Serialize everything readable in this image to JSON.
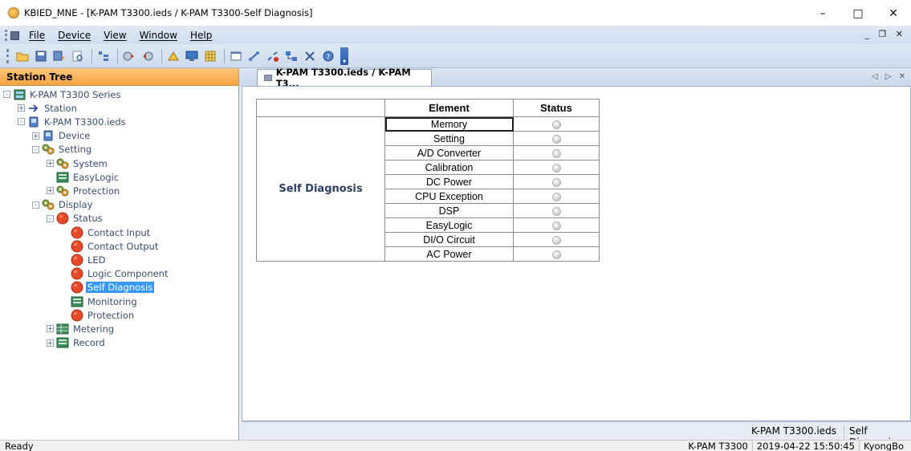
{
  "window": {
    "title": "KBIED_MNE - [K-PAM T3300.ieds / K-PAM T3300-Self Diagnosis]",
    "minimize": "–",
    "maximize": "□",
    "close": "✕"
  },
  "menu": {
    "items": [
      "File",
      "Device",
      "View",
      "Window",
      "Help"
    ],
    "mdi_controls": "_ ͆ ×"
  },
  "toolbar": {
    "icons": [
      "open-folder-icon",
      "save-icon",
      "save-all-icon",
      "print-preview-icon",
      "tree-view-icon",
      "settings-write-icon",
      "settings-read-icon",
      "compare-icon",
      "monitor-icon",
      "grid-icon",
      "window-icon",
      "connect-icon",
      "disconnect-icon",
      "network-icon",
      "close-icon",
      "help-icon"
    ]
  },
  "station_tree": {
    "header": "Station Tree",
    "nodes": [
      {
        "label": "K-PAM T3300 Series",
        "depth": 0,
        "icon": "station-icon",
        "expander": "-"
      },
      {
        "label": "Station",
        "depth": 1,
        "icon": "arrow-icon",
        "expander": "+"
      },
      {
        "label": "K-PAM T3300.ieds",
        "depth": 1,
        "icon": "device-file-icon",
        "expander": "-"
      },
      {
        "label": "Device",
        "depth": 2,
        "icon": "device-icon",
        "expander": "+"
      },
      {
        "label": "Setting",
        "depth": 2,
        "icon": "gears-icon",
        "expander": "-"
      },
      {
        "label": "System",
        "depth": 3,
        "icon": "gears-icon",
        "expander": "+"
      },
      {
        "label": "EasyLogic",
        "depth": 3,
        "icon": "logic-icon",
        "expander": ""
      },
      {
        "label": "Protection",
        "depth": 3,
        "icon": "gears-icon",
        "expander": "+"
      },
      {
        "label": "Display",
        "depth": 2,
        "icon": "gears-icon",
        "expander": "-"
      },
      {
        "label": "Status",
        "depth": 3,
        "icon": "red-dot-icon",
        "expander": "-"
      },
      {
        "label": "Contact Input",
        "depth": 4,
        "icon": "red-dot-icon",
        "expander": ""
      },
      {
        "label": "Contact Output",
        "depth": 4,
        "icon": "red-dot-icon",
        "expander": ""
      },
      {
        "label": "LED",
        "depth": 4,
        "icon": "red-dot-icon",
        "expander": ""
      },
      {
        "label": "Logic Component",
        "depth": 4,
        "icon": "red-dot-icon",
        "expander": ""
      },
      {
        "label": "Self Diagnosis",
        "depth": 4,
        "icon": "red-dot-icon",
        "expander": "",
        "selected": true
      },
      {
        "label": "Monitoring",
        "depth": 4,
        "icon": "logic-icon",
        "expander": ""
      },
      {
        "label": "Protection",
        "depth": 4,
        "icon": "red-dot-icon",
        "expander": ""
      },
      {
        "label": "Metering",
        "depth": 3,
        "icon": "table-icon",
        "expander": "+"
      },
      {
        "label": "Record",
        "depth": 3,
        "icon": "logic-icon",
        "expander": "+"
      }
    ]
  },
  "document_tab": {
    "label": "K-PAM T3300.ieds / K-PAM T3...",
    "nav": "◁ ▷ ✕"
  },
  "diagnosis_table": {
    "col_element": "Element",
    "col_status": "Status",
    "group_label": "Self Diagnosis",
    "rows": [
      {
        "element": "Memory",
        "status": "off"
      },
      {
        "element": "Setting",
        "status": "off"
      },
      {
        "element": "A/D Converter",
        "status": "off"
      },
      {
        "element": "Calibration",
        "status": "off"
      },
      {
        "element": "DC Power",
        "status": "off"
      },
      {
        "element": "CPU Exception",
        "status": "off"
      },
      {
        "element": "DSP",
        "status": "off"
      },
      {
        "element": "EasyLogic",
        "status": "off"
      },
      {
        "element": "DI/O Circuit",
        "status": "off"
      },
      {
        "element": "AC Power",
        "status": "off"
      }
    ]
  },
  "doc_status": {
    "file": "K-PAM T3300.ieds",
    "view": "Self Diagnosis"
  },
  "statusbar": {
    "ready": "Ready",
    "device": "K-PAM T3300",
    "datetime": "2019-04-22 15:50:45",
    "user": "KyongBo"
  },
  "colors": {
    "tree_header": "#f5a443",
    "selection": "#3399ff",
    "tree_text": "#3b4e72",
    "status_off": "#d6d6d6"
  }
}
